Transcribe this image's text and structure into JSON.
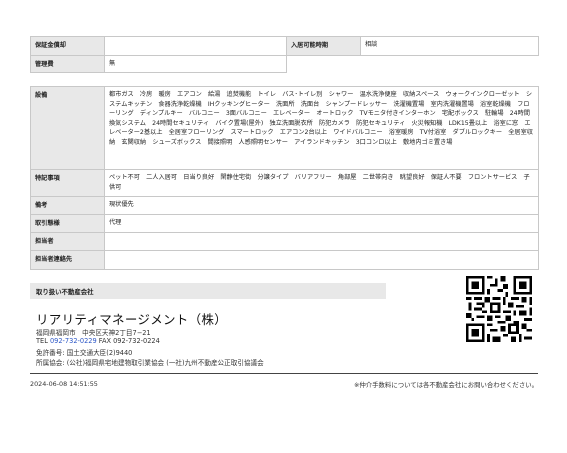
{
  "rows": {
    "deposit_label": "保証金償却",
    "deposit_value": "",
    "move_in_label": "入居可能時期",
    "move_in_value": "相談",
    "mgmt_label": "管理費",
    "mgmt_value": "無",
    "equip_label": "設備",
    "equip_value": "都市ガス　冷房　暖房　エアコン　給湯　追焚機能　トイレ　バス･トイレ別　シャワー　温水洗浄便座　収納スペース　ウォークインクローゼット　システムキッチン　食器洗浄乾燥機　IHクッキングヒーター　洗面所　洗面台　シャンプードレッサー　洗濯機置場　室内洗濯機置場　浴室乾燥機　フローリング　ディンプルキー　バルコニー　3面バルコニー　エレベーター　オートロック　TVモニタ付きインターホン　宅配ボックス　駐輪場　24時間換気システム　24時間セキュリティ　バイク置場(屋外)　独立洗面脱衣所　防犯カメラ　防犯セキュリティ　火災報知機　LDK15畳以上　浴室に窓　エレベーター2基以上　全居室フローリング　スマートロック　エアコン2台以上　ワイドバルコニー　浴室暖房　TV付浴室　ダブルロックキー　全居室収納　玄関収納　シューズボックス　間接照明　人感照明センサー　アイランドキッチン　3口コンロ以上　敷地内ゴミ置き場",
    "special_label": "特記事項",
    "special_value": "ペット不可　二人入居可　日当り良好　閑静住宅街　分譲タイプ　バリアフリー　角部屋　二世帯向き　眺望良好　保証人不要　フロントサービス　子供可",
    "remarks_label": "備考",
    "remarks_value": "現状優先",
    "deal_label": "取引態様",
    "deal_value": "代理",
    "staff_label": "担当者",
    "staff_value": "",
    "staff_contact_label": "担当者連絡先",
    "staff_contact_value": ""
  },
  "agency": {
    "header": "取り扱い不動産会社",
    "company": "リアリティマネージメント（株）",
    "address": "福岡県福岡市　中央区天神2丁目7−21",
    "tel_label": "TEL ",
    "tel": "092-732-0229",
    "fax": " FAX 092-732-0224",
    "license": "免許番号: 国土交通大臣(2)9440",
    "association": "所属協会: (公社)福岡県宅地建物取引業協会 (一社)九州不動産公正取引協議会"
  },
  "footer": {
    "timestamp": "2024-06-08 14:51:55",
    "note": "※仲介手数料については各不動産会社にお問い合わせください。"
  }
}
